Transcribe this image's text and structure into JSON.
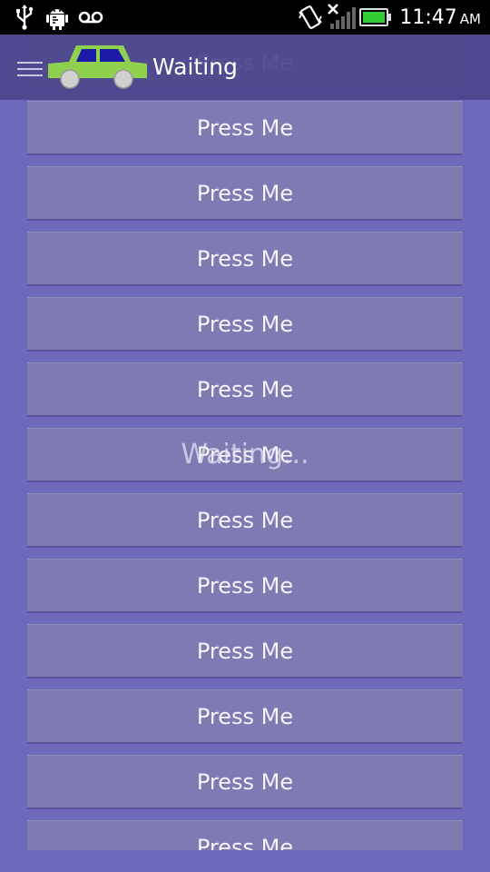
{
  "status_bar": {
    "time": "11:47",
    "ampm": "AM",
    "icons": [
      "usb-icon",
      "android-debug-icon",
      "voicemail-icon",
      "vibrate-icon",
      "no-signal-icon",
      "battery-icon"
    ],
    "battery_color": "#33cc33"
  },
  "action_bar": {
    "title": "Waiting",
    "icons": [
      "menu-icon",
      "car-icon"
    ],
    "car_color": "#8fd14f",
    "car_window_color": "#1a1aa6"
  },
  "list": {
    "buttons": [
      {
        "label": "Press Me"
      },
      {
        "label": "Press Me"
      },
      {
        "label": "Press Me"
      },
      {
        "label": "Press Me"
      },
      {
        "label": "Press Me"
      },
      {
        "label": "Press Me"
      },
      {
        "label": "Press Me"
      },
      {
        "label": "Press Me"
      },
      {
        "label": "Press Me"
      },
      {
        "label": "Press Me"
      },
      {
        "label": "Press Me"
      },
      {
        "label": "Press Me"
      },
      {
        "label": "Press Me"
      }
    ]
  },
  "overlay": {
    "text": "Waiting..."
  },
  "colors": {
    "background": "#6e69bb",
    "button": "#807ab2",
    "action_bar": "#4c468c"
  }
}
